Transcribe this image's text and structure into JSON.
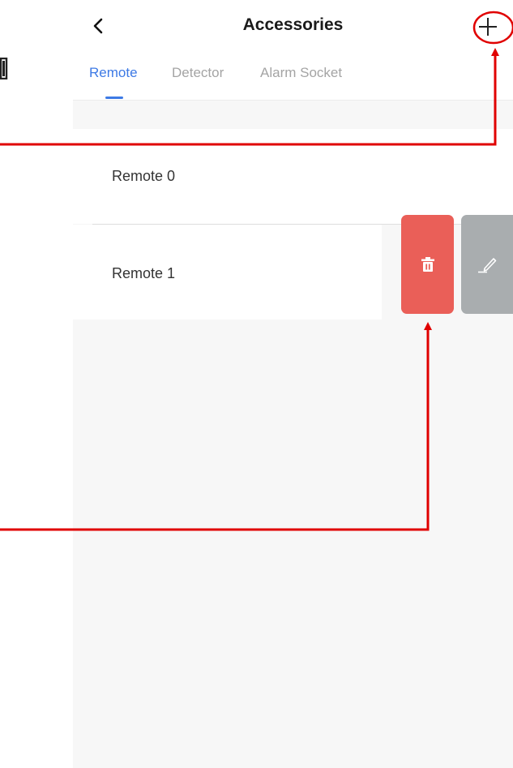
{
  "header": {
    "title": "Accessories",
    "back_icon": "chevron-left-icon",
    "add_icon": "plus-icon"
  },
  "tabs": [
    {
      "label": "Remote",
      "active": true
    },
    {
      "label": "Detector",
      "active": false
    },
    {
      "label": "Alarm Socket",
      "active": false
    }
  ],
  "list": {
    "items": [
      {
        "label": "Remote 0"
      },
      {
        "label": "Remote 1"
      }
    ]
  },
  "swipe_actions": {
    "delete_icon": "trash-icon",
    "edit_icon": "pencil-icon"
  },
  "colors": {
    "accent": "#3d7ae5",
    "delete": "#ea5f58",
    "edit": "#a9adaf",
    "annotation": "#e00000"
  }
}
